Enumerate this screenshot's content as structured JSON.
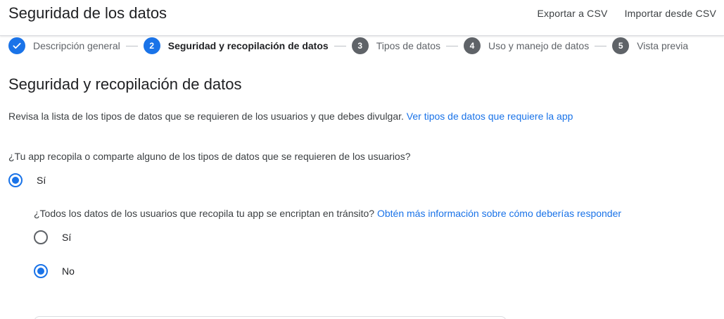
{
  "header": {
    "title": "Seguridad de los datos",
    "export_label": "Exportar a CSV",
    "import_label": "Importar desde CSV"
  },
  "stepper": {
    "steps": [
      {
        "number": "",
        "label": "Descripción general",
        "state": "done",
        "icon": "check-icon"
      },
      {
        "number": "2",
        "label": "Seguridad y recopilación de datos",
        "state": "active"
      },
      {
        "number": "3",
        "label": "Tipos de datos",
        "state": "pending"
      },
      {
        "number": "4",
        "label": "Uso y manejo de datos",
        "state": "pending"
      },
      {
        "number": "5",
        "label": "Vista previa",
        "state": "pending"
      }
    ]
  },
  "section": {
    "title": "Seguridad y recopilación de datos",
    "intro_text": "Revisa la lista de los tipos de datos que se requieren de los usuarios y que debes divulgar.",
    "intro_link": "Ver tipos de datos que requiere la app"
  },
  "question_collect": {
    "text": "¿Tu app recopila o comparte alguno de los tipos de datos que se requieren de los usuarios?",
    "options": [
      {
        "label": "Sí",
        "checked": true
      }
    ]
  },
  "question_encrypt": {
    "text": "¿Todos los datos de los usuarios que recopila tu app se encriptan en tránsito?",
    "link": "Obtén más información sobre cómo deberías responder",
    "options": [
      {
        "label": "Sí",
        "checked": false
      },
      {
        "label": "No",
        "checked": true
      }
    ]
  },
  "colors": {
    "accent": "#1a73e8",
    "text_primary": "#202124",
    "text_secondary": "#3c4043",
    "step_inactive": "#5f6368",
    "divider": "#dadce0"
  }
}
